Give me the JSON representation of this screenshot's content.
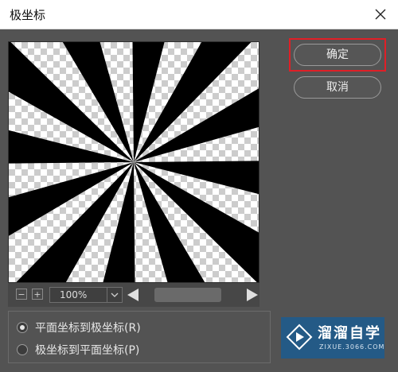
{
  "window": {
    "title": "极坐标"
  },
  "buttons": {
    "ok_label": "确定",
    "cancel_label": "取消"
  },
  "zoom": {
    "value": "100%"
  },
  "options": [
    {
      "label": "平面坐标到极坐标(R)",
      "checked": true
    },
    {
      "label": "极坐标到平面坐标(P)",
      "checked": false
    }
  ],
  "watermark": {
    "title": "溜溜自学",
    "subtitle": "ZIXUE.3066.COM"
  },
  "icons": {
    "close": "close-icon",
    "zoom_out": "zoom-out-icon",
    "zoom_in": "zoom-in-icon",
    "dropdown": "chevron-down-icon",
    "scroll_left": "scroll-left-icon",
    "scroll_right": "scroll-right-icon",
    "play": "play-icon"
  },
  "colors": {
    "dialog_bg": "#535353",
    "highlight": "#e01f26",
    "watermark_bg": "#245a86"
  }
}
